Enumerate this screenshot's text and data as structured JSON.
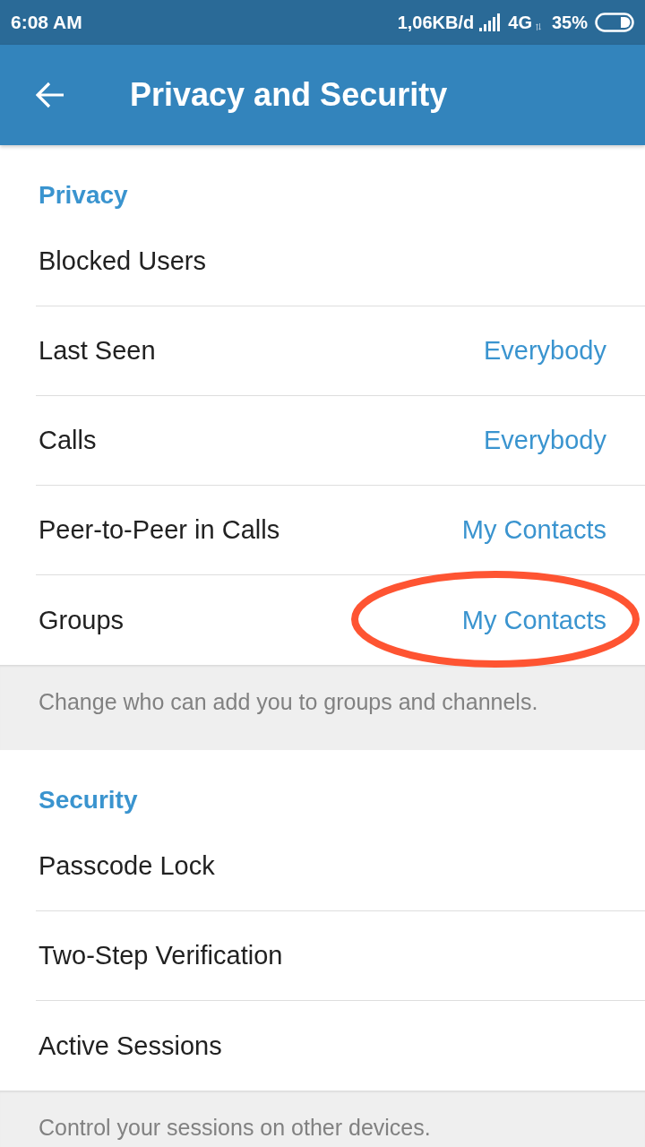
{
  "status_bar": {
    "time": "6:08 AM",
    "network_speed": "1,06KB/d",
    "network_type": "4G",
    "battery": "35%"
  },
  "app_bar": {
    "title": "Privacy and Security"
  },
  "sections": [
    {
      "header": "Privacy",
      "rows": [
        {
          "label": "Blocked Users",
          "circled": false
        },
        {
          "label": "Last Seen",
          "value": "Everybody",
          "circled": false
        },
        {
          "label": "Calls",
          "value": "Everybody",
          "circled": false
        },
        {
          "label": "Peer-to-Peer in Calls",
          "value": "My Contacts",
          "circled": false
        },
        {
          "label": "Groups",
          "value": "My Contacts",
          "circled": true
        }
      ],
      "footer": "Change who can add you to groups and channels."
    },
    {
      "header": "Security",
      "rows": [
        {
          "label": "Passcode Lock",
          "circled": false
        },
        {
          "label": "Two-Step Verification",
          "circled": false
        },
        {
          "label": "Active Sessions",
          "circled": false
        }
      ],
      "footer": "Control your sessions on other devices."
    }
  ]
}
